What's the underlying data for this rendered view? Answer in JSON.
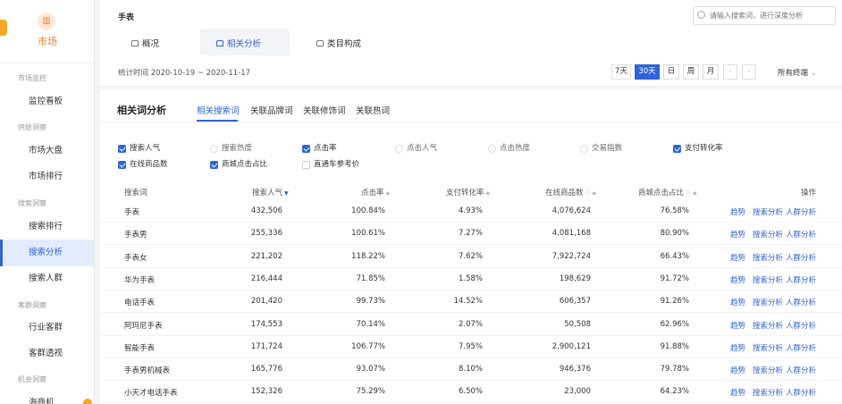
{
  "sidebar": {
    "logo_label": "市场",
    "sections": [
      {
        "title": "市场监控",
        "items": [
          "监控看板"
        ]
      },
      {
        "title": "供给洞察",
        "items": [
          "市场大盘",
          "市场排行"
        ]
      },
      {
        "title": "搜索洞察",
        "items": [
          "搜索排行",
          "搜索分析",
          "搜索人群"
        ]
      },
      {
        "title": "客群洞察",
        "items": [
          "行业客群",
          "客群透视"
        ]
      },
      {
        "title": "机会洞察",
        "items": [
          ""
        ]
      }
    ],
    "last_item_partial": "海商机",
    "active_item": "搜索分析"
  },
  "header": {
    "title": "手表",
    "search_placeholder": "请输入搜索词，进行深度分析",
    "tabs": [
      {
        "label": "概况"
      },
      {
        "label": "相关分析"
      },
      {
        "label": "类目构成"
      }
    ],
    "active_tab": "相关分析",
    "range": "统计时间 2020-10-19 ~ 2020-11-17",
    "periods": [
      "7天",
      "30天",
      "日",
      "周",
      "月"
    ],
    "active_period": "30天",
    "prev": "‹",
    "next": "›",
    "terminal": "所有终端"
  },
  "main": {
    "title": "相关词分析",
    "subtabs": [
      "相关搜索词",
      "关联品牌词",
      "关联修饰词",
      "关联热词"
    ],
    "active_subtab": "相关搜索词",
    "checkboxes": [
      {
        "label": "搜索人气",
        "state": "on"
      },
      {
        "label": "搜索热度",
        "state": "dis"
      },
      {
        "label": "点击率",
        "state": "on"
      },
      {
        "label": "点击人气",
        "state": "dis"
      },
      {
        "label": "点击热度",
        "state": "dis"
      },
      {
        "label": "交易指数",
        "state": "dis"
      },
      {
        "label": "支付转化率",
        "state": "on"
      },
      {
        "label": "在线商品数",
        "state": "on"
      },
      {
        "label": "商城点击占比",
        "state": "on"
      },
      {
        "label": "直通车参考价",
        "state": "off"
      }
    ],
    "columns": [
      "搜索词",
      "搜索人气",
      "点击率",
      "支付转化率",
      "在线商品数",
      "商城点击占比",
      "操作"
    ],
    "ops": [
      "趋势",
      "搜索分析",
      "人群分析"
    ],
    "rows": [
      [
        "手表",
        "432,506",
        "100.84%",
        "4.93%",
        "4,076,624",
        "76.58%"
      ],
      [
        "手表男",
        "255,336",
        "100.61%",
        "7.27%",
        "4,081,168",
        "80.90%"
      ],
      [
        "手表女",
        "221,202",
        "118.22%",
        "7.62%",
        "7,922,724",
        "66.43%"
      ],
      [
        "华为手表",
        "216,444",
        "71.85%",
        "1.58%",
        "198,629",
        "91.72%"
      ],
      [
        "电话手表",
        "201,420",
        "99.73%",
        "14.52%",
        "606,357",
        "91.26%"
      ],
      [
        "阿玛尼手表",
        "174,553",
        "70.14%",
        "2.07%",
        "50,508",
        "62.96%"
      ],
      [
        "智能手表",
        "171,724",
        "106.77%",
        "7.95%",
        "2,900,121",
        "91.88%"
      ],
      [
        "手表男机械表",
        "165,776",
        "93.07%",
        "8.10%",
        "946,376",
        "79.78%"
      ],
      [
        "小天才电话手表",
        "152,326",
        "75.29%",
        "6.50%",
        "23,000",
        "64.23%"
      ]
    ]
  }
}
